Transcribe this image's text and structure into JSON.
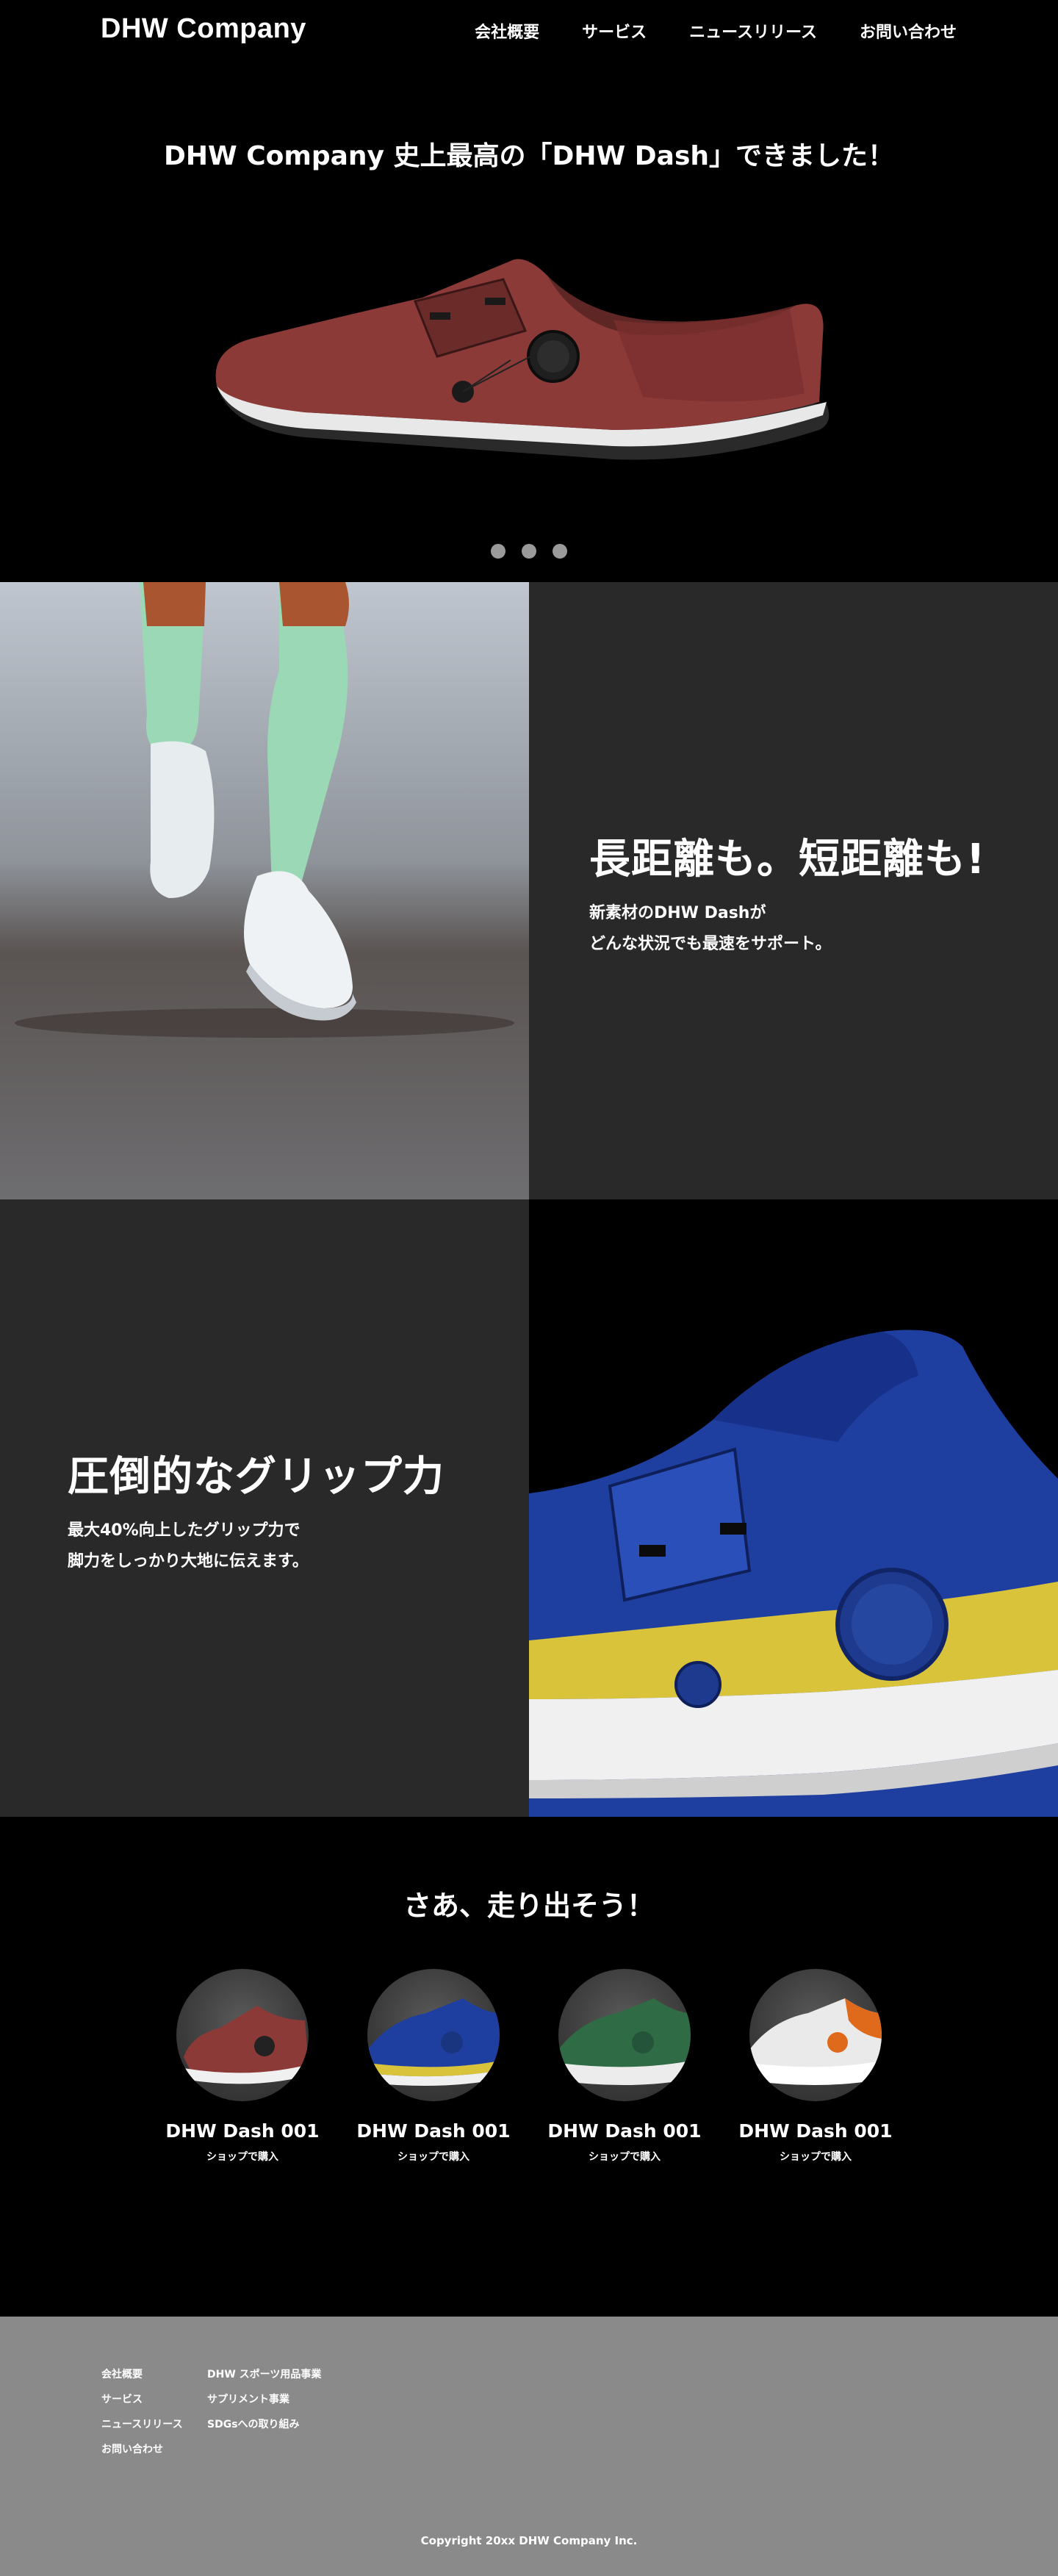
{
  "header": {
    "logo": "DHW Company",
    "nav": [
      "会社概要",
      "サービス",
      "ニュースリリース",
      "お問い合わせ"
    ]
  },
  "hero": {
    "title": "DHW Company 史上最高の「DHW Dash」できました！",
    "slides_total": 3
  },
  "feature1": {
    "heading": "長距離も。短距離も!",
    "text_line1": "新素材のDHW Dashが",
    "text_line2": "どんな状況でも最速をサポート。"
  },
  "feature2": {
    "heading": "圧倒的なグリップ力",
    "text_line1": "最大40%向上したグリップ力で",
    "text_line2": "脚力をしっかり大地に伝えます。"
  },
  "products": {
    "title": "さあ、走り出そう！",
    "items": [
      {
        "name": "DHW Dash 001",
        "link": "ショップで購入",
        "color": "#8c3a38"
      },
      {
        "name": "DHW Dash 001",
        "link": "ショップで購入",
        "color": "#1f3fa0"
      },
      {
        "name": "DHW Dash 001",
        "link": "ショップで購入",
        "color": "#2f6b45"
      },
      {
        "name": "DHW Dash 001",
        "link": "ショップで購入",
        "color": "#e9e9e9"
      }
    ]
  },
  "footer": {
    "col1": [
      "会社概要",
      "サービス",
      "ニュースリリース",
      "お問い合わせ"
    ],
    "col2": [
      "DHW スポーツ用品事業",
      "サプリメント事業",
      "SDGsへの取り組み"
    ],
    "copyright": "Copyright 20xx DHW Company Inc."
  },
  "colors": {
    "background": "#000000",
    "panel": "#292929",
    "footer": "#8a8a8a",
    "dot": "#9a9a9a"
  }
}
